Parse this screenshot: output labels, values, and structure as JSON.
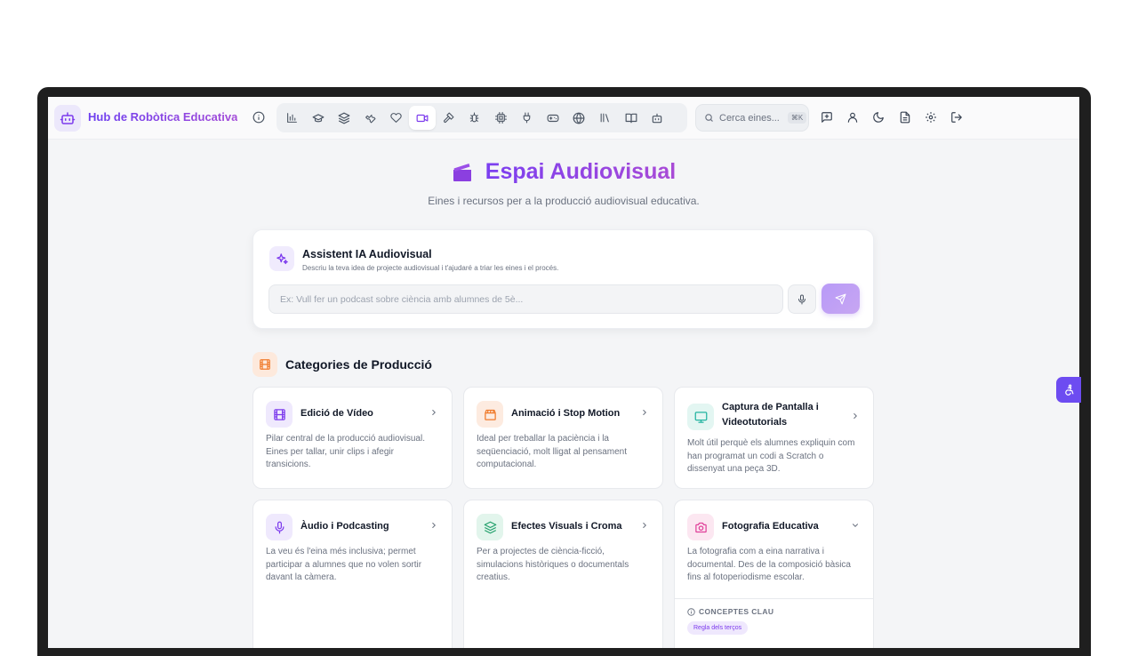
{
  "app": {
    "brand": "Hub de Robòtica Educativa",
    "colors": {
      "accent": "#7c3aed",
      "accent2": "#a94bd6",
      "bg": "#f4f5f7"
    }
  },
  "nav": {
    "icons": [
      "bar-chart-icon",
      "graduation-cap-icon",
      "layers-icon",
      "wrench-icon",
      "heart-icon",
      "video-icon",
      "hammer-icon",
      "bug-icon",
      "cpu-icon",
      "plug-icon",
      "gamepad-icon",
      "globe-icon",
      "library-icon",
      "book-open-icon",
      "robot-icon"
    ],
    "active": "video-icon"
  },
  "search": {
    "placeholder": "Cerca eines...",
    "shortcut": "⌘K"
  },
  "toolbar_right": [
    "feedback-icon",
    "user-icon",
    "moon-icon",
    "document-icon",
    "settings-icon",
    "logout-icon"
  ],
  "page": {
    "title": "Espai Audiovisual",
    "subtitle": "Eines i recursos per a la producció audiovisual educativa."
  },
  "assistant": {
    "title": "Assistent IA Audiovisual",
    "description": "Descriu la teva idea de projecte audiovisual i t'ajudaré a triar les eines i el procés.",
    "placeholder": "Ex: Vull fer un podcast sobre ciència amb alumnes de 5è..."
  },
  "categories": {
    "title": "Categories de Producció",
    "items": [
      {
        "title": "Edició de Vídeo",
        "description": "Pilar central de la producció audiovisual. Eines per tallar, unir clips i afegir transicions.",
        "icon": "film-icon",
        "color": "#7c3aed"
      },
      {
        "title": "Animació i Stop Motion",
        "description": "Ideal per treballar la paciència i la seqüenciació, molt lligat al pensament computacional.",
        "icon": "clapperboard-icon",
        "color": "#f07a2a"
      },
      {
        "title": "Captura de Pantalla i Videotutorials",
        "description": "Molt útil perquè els alumnes expliquin com han programat un codi a Scratch o dissenyat una peça 3D.",
        "icon": "monitor-icon",
        "color": "#22b3a0"
      },
      {
        "title": "Àudio i Podcasting",
        "description": "La veu és l'eina més inclusiva; permet participar a alumnes que no volen sortir davant la càmera.",
        "icon": "microphone-icon",
        "color": "#7c3aed"
      },
      {
        "title": "Efectes Visuals i Croma",
        "description": "Per a projectes de ciència-ficció, simulacions històriques o documentals creatius.",
        "icon": "layers-icon",
        "color": "#22a06b"
      },
      {
        "title": "Fotografia Educativa",
        "description": "La fotografia com a eina narrativa i documental. Des de la composició bàsica fins al fotoperiodisme escolar.",
        "icon": "camera-icon",
        "color": "#e0409a",
        "expanded": true,
        "key_concepts_label": "CONCEPTES CLAU",
        "tags": [
          "Regla dels terços"
        ]
      }
    ]
  }
}
